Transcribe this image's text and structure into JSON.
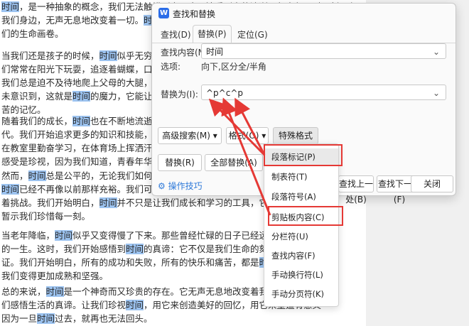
{
  "document": {
    "lines": [
      "时间，是一种抽象的概念，我们无法触摸到它，也无法看到它的流逝，但它却无时无刻不在",
      "我们身边，无声无息地改变着一切。时间就像",
      "们的生命画卷。",
      "",
      "当我们还是孩子的时候，时间似乎无穷无尽，",
      "们常常在阳光下玩耍，追逐着蝴蝶，口袋里装",
      "我们总是迫不及待地爬上父母的大腿，期待着",
      "未意识到，这就是时间的魔力，它能让我们记",
      "苦的记忆。",
      "",
      "随着我们的成长，时间也在不断地流逝。那些",
      "代。我们开始追求更多的知识和技能，希望能",
      "在教室里勤奋学习，在体育场上挥洒汗水，在",
      "感受是珍视，因为我们知道，青春年华一旦过",
      "",
      "然而，时间总是公平的，无论我们如何挣扎，",
      "时间已经不再像以前那样充裕。我们可能在事",
      "着挑战。我们开始明白，时间并不只是让我们成长和学习的工具，它也是推动我们走",
      "暂示我们珍惜每一刻。",
      "",
      "当老年降临，时间似乎又变得慢了下来。那些曾经忙碌的日子已经远去，我们开始",
      "的一生。这时，我们开始感悟到时间的真谛：它不仅是我们生命的刻度，也是我们",
      "证。我们开始明白，所有的成功和失败，所有的快乐和痛苦，都是时间赐予我们的",
      "我们变得更加成熟和坚强。",
      "",
      "总的来说，时间是一个神奇而又珍贵的存在。它无声无息地改变着我们，让我们成",
      "们感悟生活的真谛。让我们珍视时间，用它来创造美好的回忆，用它来塑造有意义",
      "因为一旦时间过去，就再也无法回头。"
    ]
  },
  "dialog": {
    "app_icon_letter": "W",
    "title": "查找和替换",
    "tabs": [
      "查找(D)",
      "替换(P)",
      "定位(G)"
    ],
    "find_label": "查找内容(N):",
    "find_value": "时间",
    "options_label": "选项:",
    "options_value": "向下,区分全/半角",
    "replace_label": "替换为(I):",
    "replace_value": "^p^c^p",
    "btn_advanced": "高级搜索(M) ▾",
    "btn_format": "格式(O) ▾",
    "btn_special": "特殊格式(E) ▾",
    "btn_replace": "替换(R)",
    "btn_replace_all": "全部替换(A)",
    "btn_find_prev": "查找上一处(B)",
    "btn_find_next": "查找下一处(F)",
    "btn_close": "关闭",
    "tips_label": "操作技巧"
  },
  "menu": {
    "items": [
      "段落标记(P)",
      "制表符(T)",
      "段落符号(A)",
      "剪贴板内容(C)",
      "分栏符(U)",
      "查找内容(F)",
      "手动换行符(L)",
      "手动分页符(K)"
    ]
  },
  "colors": {
    "annotation": "#e53935",
    "accent": "#2b6de8",
    "highlight": "#9cc3f0"
  }
}
